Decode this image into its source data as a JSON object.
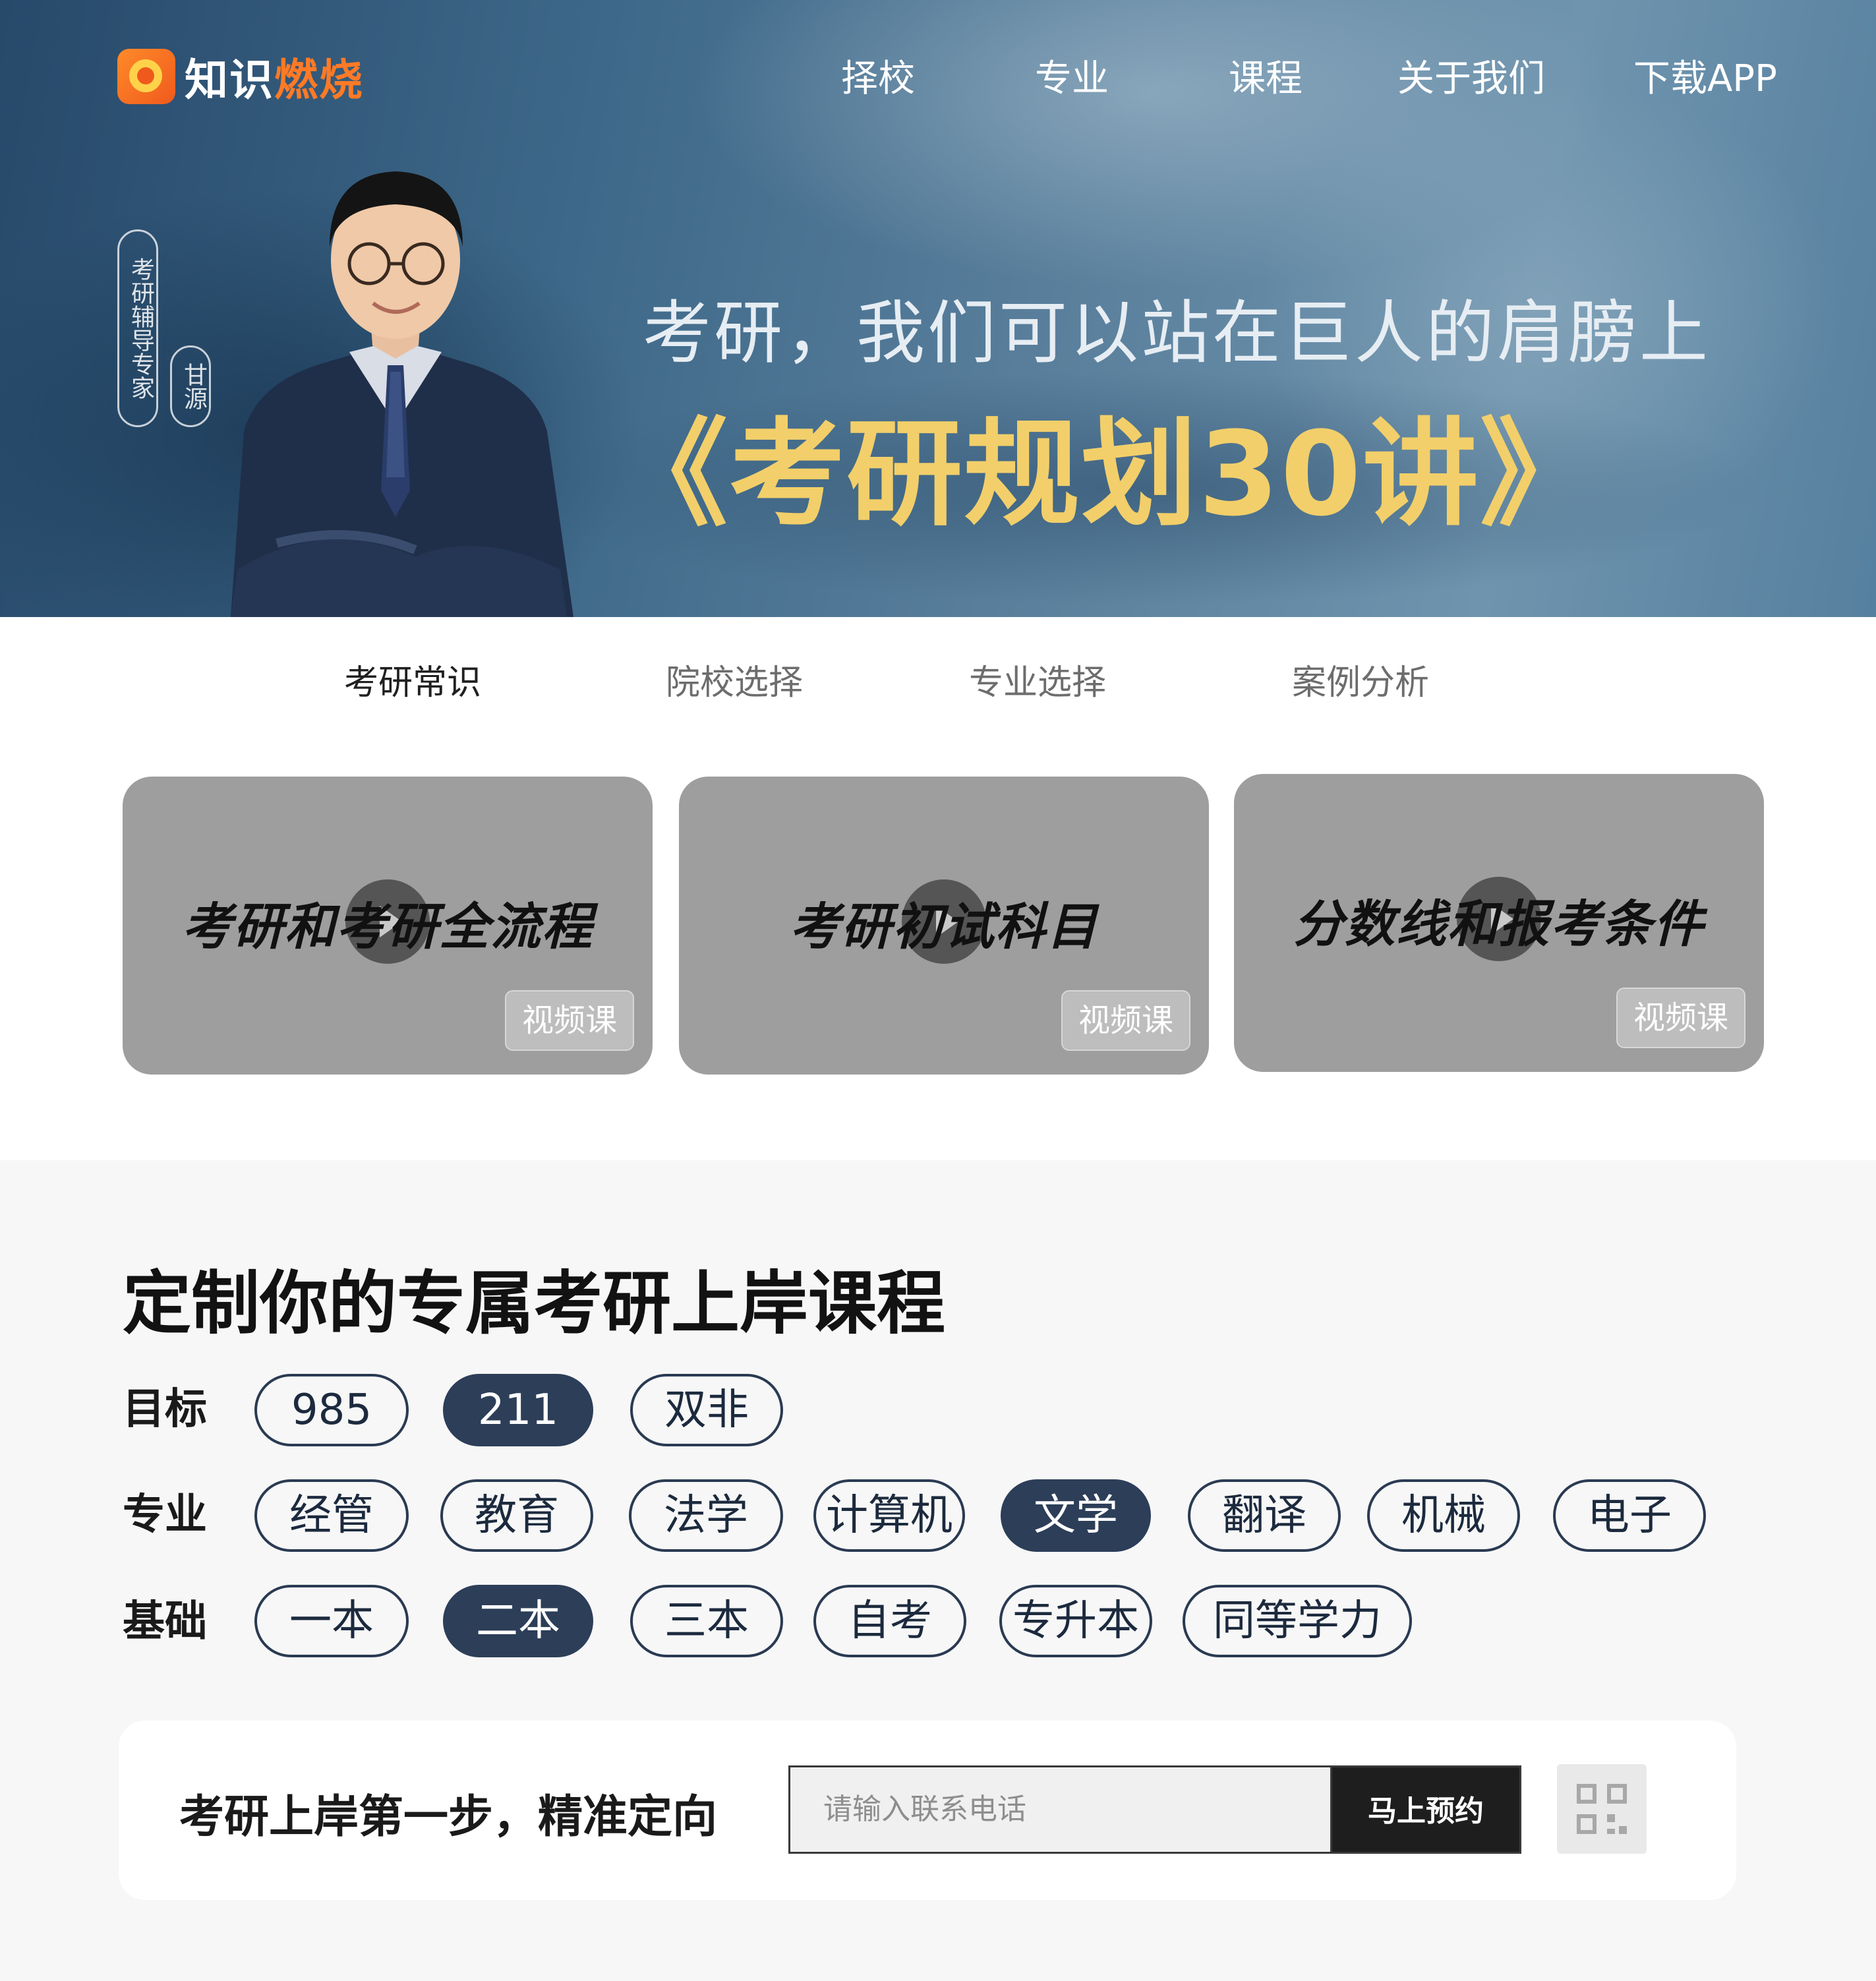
{
  "brand": {
    "logo_icon": "flame-logo-icon",
    "name_part1": "知识",
    "name_part2": "燃烧",
    "accent_color": "#ff7a26"
  },
  "nav": {
    "items": [
      "择校",
      "专业",
      "课程",
      "关于我们",
      "下载APP"
    ]
  },
  "hero": {
    "expert_role": "考研辅导专家",
    "expert_name": "甘源",
    "slogan": "考研，我们可以站在巨人的肩膀上",
    "headline": "《考研规划30讲》",
    "headline_color": "#f2cf6a"
  },
  "tabs": {
    "items": [
      "考研常识",
      "院校选择",
      "专业选择",
      "案例分析"
    ],
    "active_index": 0
  },
  "videos": [
    {
      "title": "考研和考研全流程",
      "badge": "视频课",
      "icon": "play-icon"
    },
    {
      "title": "考研初试科目",
      "badge": "视频课",
      "icon": "play-icon"
    },
    {
      "title": "分数线和报考条件",
      "badge": "视频课",
      "icon": "play-icon"
    }
  ],
  "customize": {
    "title": "定制你的专属考研上岸课程",
    "rows": [
      {
        "label": "目标",
        "options": [
          "985",
          "211",
          "双非"
        ],
        "selected": "211"
      },
      {
        "label": "专业",
        "options": [
          "经管",
          "教育",
          "法学",
          "计算机",
          "文学",
          "翻译",
          "机械",
          "电子"
        ],
        "selected": "文学"
      },
      {
        "label": "基础",
        "options": [
          "一本",
          "二本",
          "三本",
          "自考",
          "专升本",
          "同等学力"
        ],
        "selected": "二本"
      }
    ],
    "selected_color": "#2c3e58"
  },
  "booking": {
    "text": "考研上岸第一步，精准定向",
    "phone_placeholder": "请输入联系电话",
    "button_label": "马上预约",
    "qr_icon": "qr-code-icon"
  }
}
